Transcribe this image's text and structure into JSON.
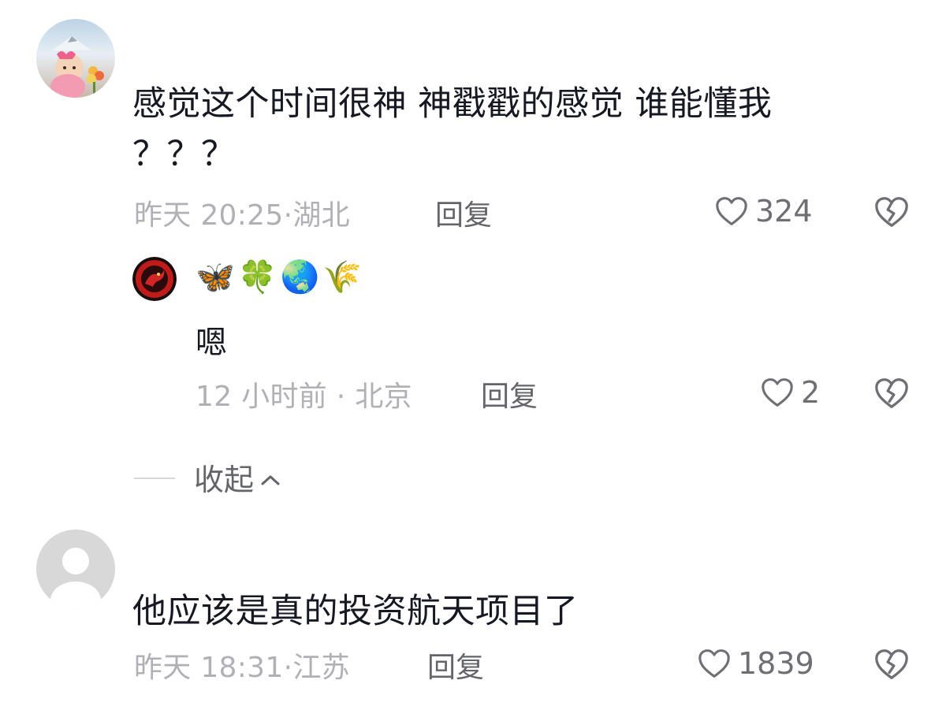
{
  "comments": [
    {
      "text": "感觉这个时间很神 神戳戳的感觉 谁能懂我\n？？？",
      "time_location": "昨天 20:25·湖北",
      "reply_label": "回复",
      "likes": "324"
    },
    {
      "text": "他应该是真的投资航天项目了",
      "time_location": "昨天 18:31·江苏",
      "reply_label": "回复",
      "likes": "1839"
    }
  ],
  "reply": {
    "username": "🦋🍀🌏🌾",
    "text": "嗯",
    "time_location": "12 小时前 · 北京",
    "reply_label": "回复",
    "likes": "2"
  },
  "collapse_label": "收起",
  "icons": {
    "like": "heart-outline-icon",
    "dislike": "broken-heart-icon",
    "collapse": "chevron-up-icon"
  },
  "colors": {
    "text_primary": "#161823",
    "meta_gray": "#b0b1b6",
    "action_gray": "#63656b"
  }
}
